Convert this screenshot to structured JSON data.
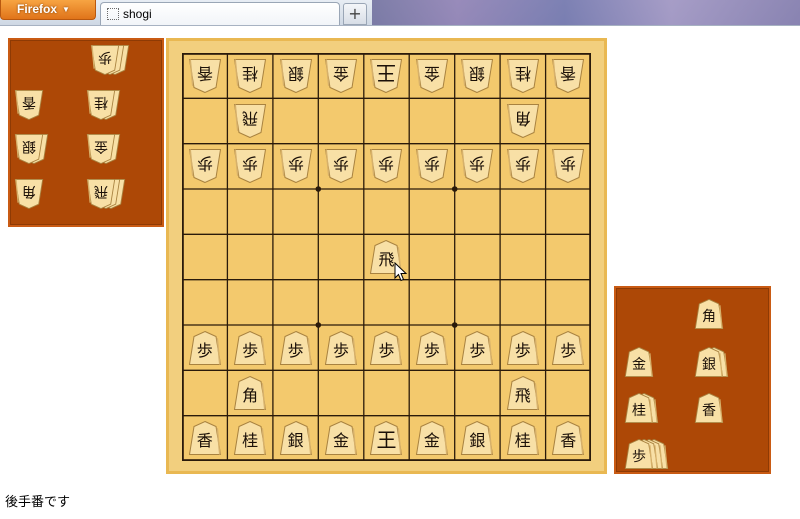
{
  "browser": {
    "menu_button_label": "Firefox",
    "tab_title": "shogi",
    "new_tab_label": "+"
  },
  "board": {
    "gote_row1": [
      "香",
      "桂",
      "銀",
      "金",
      "王",
      "金",
      "銀",
      "桂",
      "香"
    ],
    "gote_row2": {
      "rook": "飛",
      "bishop": "角"
    },
    "gote_pawns": [
      "歩",
      "歩",
      "歩",
      "歩",
      "歩",
      "歩",
      "歩",
      "歩",
      "歩"
    ],
    "center_piece": "飛",
    "sente_pawns": [
      "歩",
      "歩",
      "歩",
      "歩",
      "歩",
      "歩",
      "歩",
      "歩",
      "歩"
    ],
    "sente_row8": {
      "bishop": "角",
      "rook": "飛"
    },
    "sente_row9": [
      "香",
      "桂",
      "銀",
      "金",
      "王",
      "金",
      "銀",
      "桂",
      "香"
    ]
  },
  "komadai_gote": {
    "pieces": [
      "歩",
      "香",
      "桂",
      "銀",
      "金",
      "角",
      "飛"
    ]
  },
  "komadai_sente": {
    "pieces": [
      "角",
      "金",
      "銀",
      "桂",
      "香",
      "歩"
    ]
  },
  "status": "後手番です"
}
